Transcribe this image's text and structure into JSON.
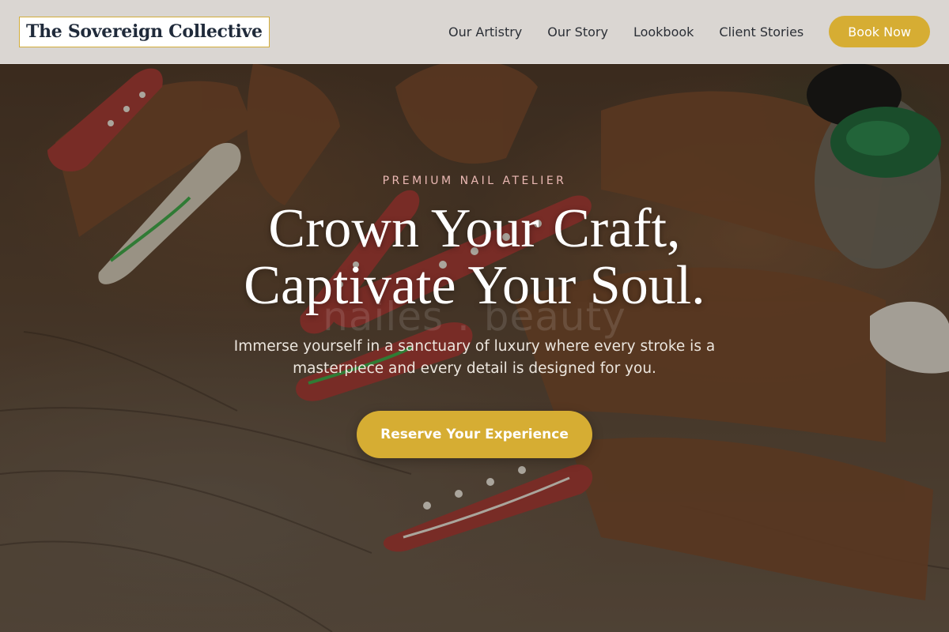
{
  "header": {
    "brand": "The Sovereign Collective",
    "nav": [
      {
        "label": "Our Artistry"
      },
      {
        "label": "Our Story"
      },
      {
        "label": "Lookbook"
      },
      {
        "label": "Client Stories"
      }
    ],
    "book_button": "Book Now"
  },
  "hero": {
    "eyebrow": "PREMIUM NAIL ATELIER",
    "headline_line1": "Crown Your Craft,",
    "headline_line2": "Captivate Your Soul.",
    "watermark": "nailes . beauty",
    "subtext": "Immerse yourself in a sanctuary of luxury where every stroke is a masterpiece and every detail is designed for you.",
    "cta": "Reserve Your Experience",
    "background_image": "hands-with-painted-nails-on-wood"
  },
  "colors": {
    "accent_gold": "#d6ad33",
    "eyebrow_pink": "#ebb9b4",
    "brand_text": "#1f2a3a",
    "nail_red": "#a83a34",
    "ring_green": "#1e6b3c"
  }
}
